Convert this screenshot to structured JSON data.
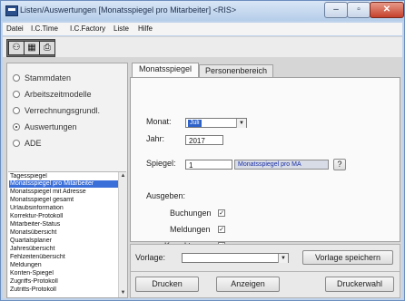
{
  "window": {
    "title": "Listen/Auswertungen [Monatsspiegel pro Mitarbeiter]  <RIS>",
    "minimize_glyph": "–",
    "maximize_glyph": "▫",
    "close_glyph": "✕"
  },
  "menu": [
    "Datei",
    "I.C.Time",
    "I.C.Factory",
    "Liste",
    "Hilfe"
  ],
  "toolbar": {
    "buttons": [
      {
        "icon": "people-icon",
        "glyph": "⚇"
      },
      {
        "icon": "table-icon",
        "glyph": "▦"
      },
      {
        "icon": "printer-icon",
        "glyph": "⎙"
      }
    ]
  },
  "categories": [
    {
      "label": "Stammdaten",
      "selected": false
    },
    {
      "label": "Arbeitszeitmodelle",
      "selected": false
    },
    {
      "label": "Verrechnungsgrundl.",
      "selected": false
    },
    {
      "label": "Auswertungen",
      "selected": true
    },
    {
      "label": "ADE",
      "selected": false
    }
  ],
  "reports": {
    "items": [
      "Tagesspiegel",
      "Monatsspiegel pro Mitarbeiter",
      "Monatsspiegel mit Adresse",
      "Monatsspiegel gesamt",
      "Urlaubsinformation",
      "Korrektur-Protokoll",
      "Mitarbeiter-Status",
      "Monatsübersicht",
      "Quartalsplaner",
      "Jahresübersicht",
      "Fehlzeitenübersicht",
      "Meldungen",
      "Konten-Spiegel",
      "Zugriffs-Protokoll",
      "Zutritts-Protokoll"
    ],
    "selected_index": 1
  },
  "tabs": [
    "Monatsspiegel",
    "Personenbereich"
  ],
  "form": {
    "monat_label": "Monat:",
    "monat_value": "Juli",
    "jahr_label": "Jahr:",
    "jahr_value": "2017",
    "spiegel_label": "Spiegel:",
    "spiegel_value": "1",
    "spiegel_desc": "Monatsspiegel pro MA",
    "help_label": "?",
    "ausgeben_label": "Ausgeben:",
    "options": [
      {
        "label": "Buchungen",
        "checked": true
      },
      {
        "label": "Meldungen",
        "checked": true
      },
      {
        "label": "Korrekturen",
        "checked": true
      }
    ]
  },
  "bottom": {
    "vorlage_label": "Vorlage:",
    "vorlage_value": "",
    "save_template_label": "Vorlage speichern",
    "print_label": "Drucken",
    "show_label": "Anzeigen",
    "printer_label": "Druckerwahl"
  }
}
